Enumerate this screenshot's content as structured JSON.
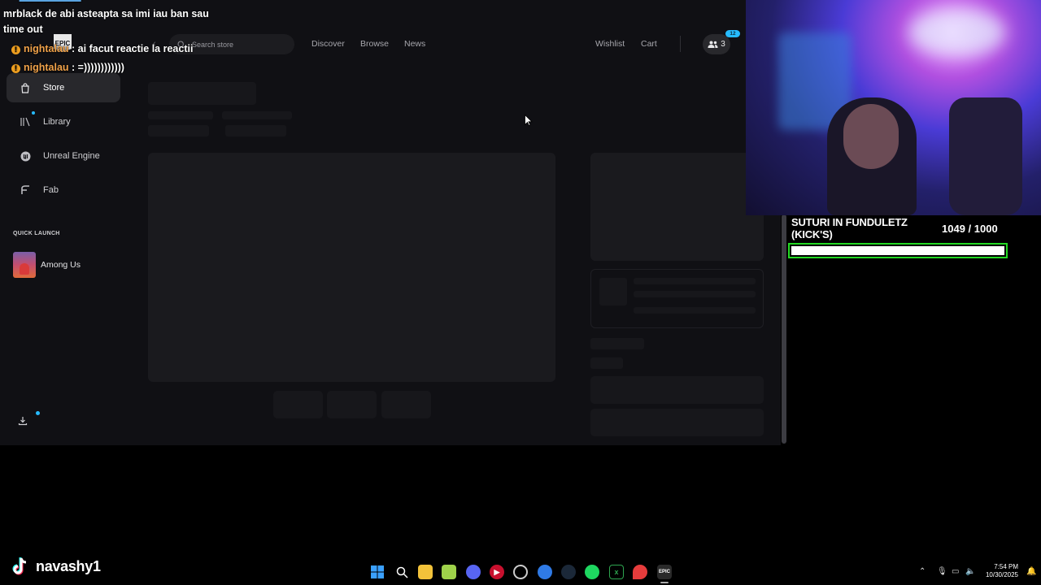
{
  "sidebar": {
    "logo_text": "EPIC",
    "items": [
      {
        "label": "Store",
        "icon": "shopping-bag-icon"
      },
      {
        "label": "Library",
        "icon": "library-icon"
      },
      {
        "label": "Unreal Engine",
        "icon": "unreal-engine-icon"
      },
      {
        "label": "Fab",
        "icon": "fab-icon"
      }
    ],
    "quick_launch_title": "QUICK LAUNCH",
    "quick_launch_items": [
      {
        "label": "Among Us"
      }
    ]
  },
  "topbar": {
    "search_placeholder": "Search store",
    "nav": [
      "Discover",
      "Browse",
      "News"
    ],
    "wishlist": "Wishlist",
    "cart": "Cart",
    "friends_count": "3",
    "friends_badge": "12"
  },
  "chat": [
    {
      "user": "",
      "text": "mrblack de abi asteapta sa imi iau ban sau"
    },
    {
      "user": "",
      "text": "time out"
    },
    {
      "user": "nightalau",
      "text": ": ai facut reactie la reactii"
    },
    {
      "user": "nightalau",
      "text": ": =))))))))))))"
    }
  ],
  "goal": {
    "title": "SUTURI IN FUNDULETZ (KICK'S)",
    "count": "1049  / 1000",
    "progress": 1.0,
    "bar_color": "#23d923"
  },
  "watermark": {
    "name": "navashy1"
  },
  "taskbar": {
    "time": "7:54 PM",
    "date": "10/30/2025"
  },
  "colors": {
    "accent": "#26bbff",
    "app_bg": "#101014",
    "chat_user": "#f0a24a"
  }
}
